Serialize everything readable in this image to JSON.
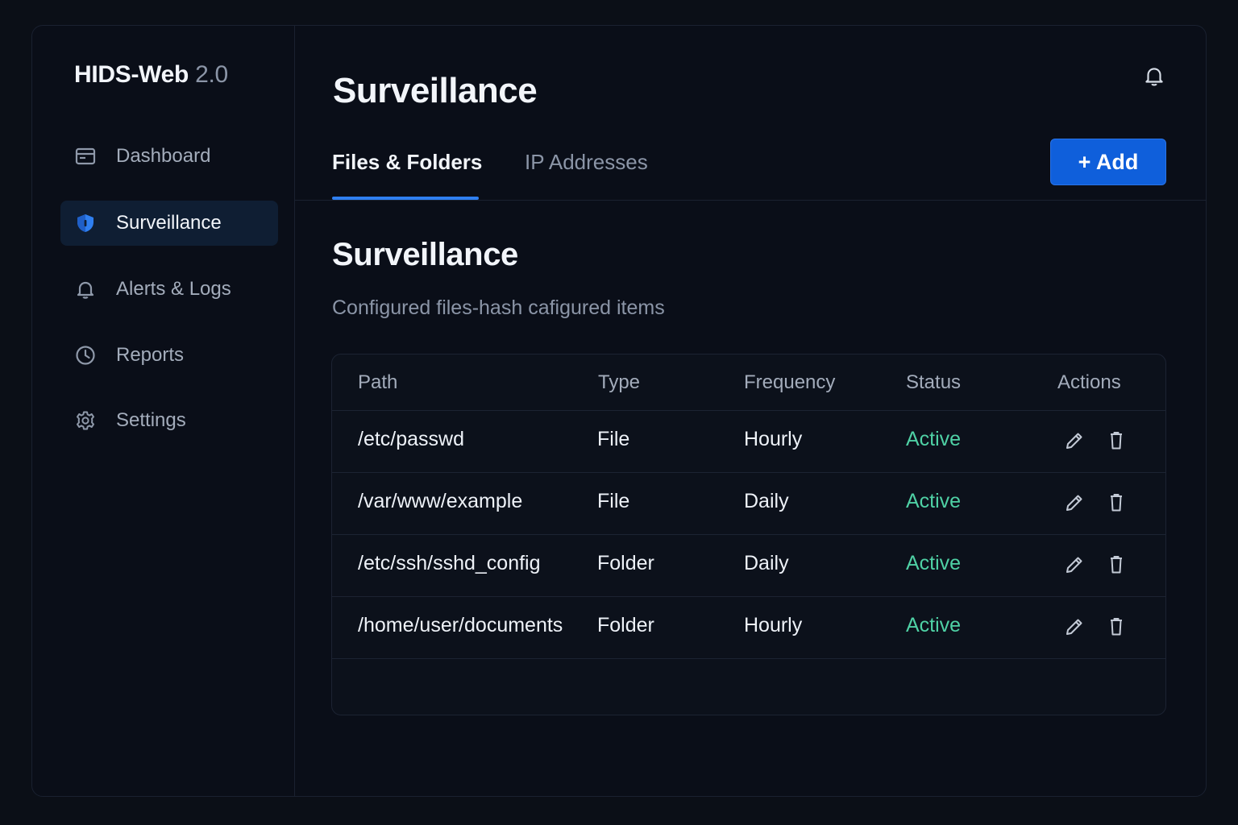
{
  "app": {
    "brand_name": "HIDS-Web",
    "brand_version": "2.0"
  },
  "sidebar": {
    "items": [
      {
        "label": "Dashboard",
        "icon": "dashboard-icon",
        "active": false
      },
      {
        "label": "Surveillance",
        "icon": "shield-icon",
        "active": true
      },
      {
        "label": "Alerts & Logs",
        "icon": "bell-icon",
        "active": false
      },
      {
        "label": "Reports",
        "icon": "clock-icon",
        "active": false
      },
      {
        "label": "Settings",
        "icon": "gear-icon",
        "active": false
      }
    ]
  },
  "header": {
    "title": "Surveillance",
    "notification_icon": "bell-icon"
  },
  "tabs": [
    {
      "label": "Files & Folders",
      "active": true
    },
    {
      "label": "IP Addresses",
      "active": false
    }
  ],
  "toolbar": {
    "add_label": "+ Add"
  },
  "section": {
    "title": "Surveillance",
    "subtitle": "Configured files-hash cafigured items"
  },
  "table": {
    "columns": [
      "Path",
      "Type",
      "Frequency",
      "Status",
      "Actions"
    ],
    "rows": [
      {
        "path": "/etc/passwd",
        "type": "File",
        "frequency": "Hourly",
        "status": "Active"
      },
      {
        "path": "/var/www/example",
        "type": "File",
        "frequency": "Daily",
        "status": "Active"
      },
      {
        "path": "/etc/ssh/sshd_config",
        "type": "Folder",
        "frequency": "Daily",
        "status": "Active"
      },
      {
        "path": "/home/user/documents",
        "type": "Folder",
        "frequency": "Hourly",
        "status": "Active"
      }
    ],
    "row_actions": [
      "pencil-icon",
      "trash-icon"
    ]
  },
  "colors": {
    "background": "#0a0e18",
    "accent": "#0f5fdb",
    "tab_indicator": "#2f7ff0",
    "status_active": "#4fd1a5",
    "active_nav_bg": "#0f1e33"
  }
}
